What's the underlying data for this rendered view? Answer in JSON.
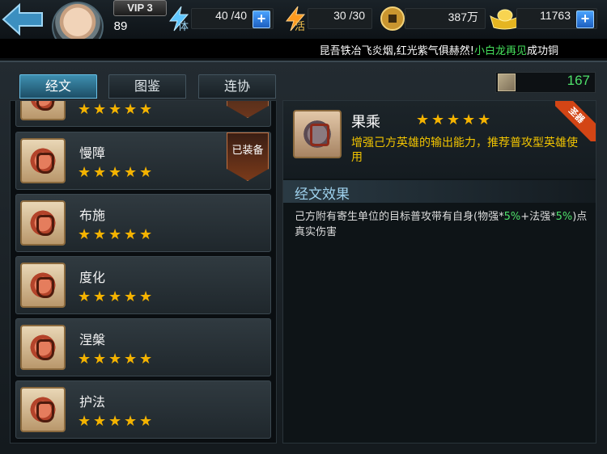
{
  "top_bar": {
    "vip_label": "VIP 3",
    "level": "89",
    "stamina": {
      "label": "体",
      "value": "40 /40"
    },
    "vitality": {
      "label": "活",
      "value": "30 /30"
    },
    "coins": {
      "value": "387万"
    },
    "gold": {
      "value": "11763"
    },
    "plus_symbol": "+"
  },
  "marquee": {
    "before": "昆吾铁冶飞炎烟,红光紫气俱赫然!",
    "highlight": "小白龙再见",
    "after": "成功铜"
  },
  "tabs": [
    {
      "label": "经文",
      "active": true
    },
    {
      "label": "图鉴",
      "active": false
    },
    {
      "label": "连协",
      "active": false
    }
  ],
  "points": "167",
  "sutra_list": [
    {
      "name": "",
      "stars": 5,
      "equipped": false
    },
    {
      "name": "慢障",
      "stars": 5,
      "equipped": true,
      "equipped_label": "已装备"
    },
    {
      "name": "布施",
      "stars": 5,
      "equipped": false
    },
    {
      "name": "度化",
      "stars": 5,
      "equipped": false
    },
    {
      "name": "涅槃",
      "stars": 5,
      "equipped": false
    },
    {
      "name": "护法",
      "stars": 5,
      "equipped": false
    }
  ],
  "star_glyph": "★",
  "detail": {
    "name": "果乘",
    "stars": 5,
    "description": "增强己方英雄的输出能力，推荐普攻型英雄使用",
    "corner_tag": "圣器",
    "effect_title": "经文效果",
    "effect_parts": [
      {
        "text": "己方附有寄生单位的目标普攻带有自身(物强*",
        "green": false
      },
      {
        "text": "5%",
        "green": true
      },
      {
        "text": "+法强*",
        "green": false
      },
      {
        "text": "5%",
        "green": true
      },
      {
        "text": ")点真实伤害",
        "green": false
      }
    ]
  },
  "colors": {
    "accent_blue": "#3e8fb0",
    "star_gold": "#f4b300",
    "desc_yellow": "#f2c400",
    "value_green": "#4ee06a"
  }
}
